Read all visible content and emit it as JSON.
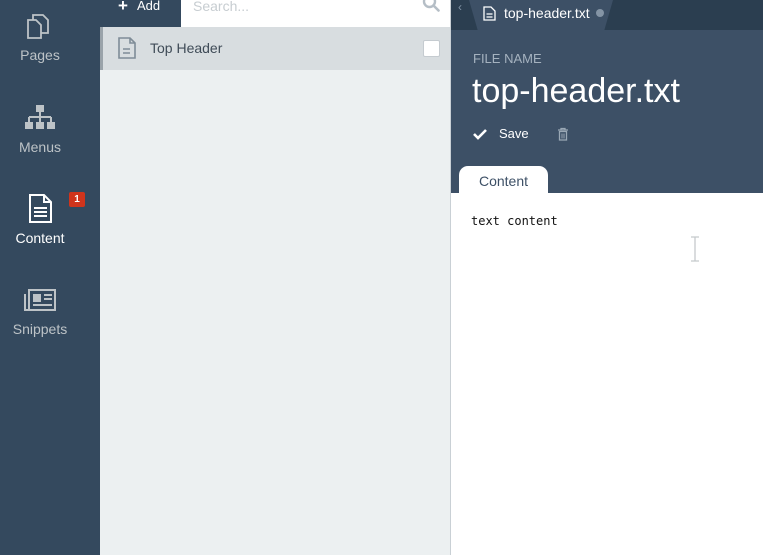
{
  "nav": {
    "items": [
      {
        "label": "Pages",
        "icon": "pages-icon"
      },
      {
        "label": "Menus",
        "icon": "menus-icon"
      },
      {
        "label": "Content",
        "icon": "content-icon",
        "active": true,
        "badge": "1"
      },
      {
        "label": "Snippets",
        "icon": "snippets-icon"
      }
    ]
  },
  "toolbar": {
    "add_label": "Add",
    "search_placeholder": "Search..."
  },
  "list": {
    "items": [
      {
        "name": "Top Header",
        "selected": true,
        "checked": false
      }
    ]
  },
  "editor": {
    "tab_title": "top-header.txt",
    "file_name_label": "FILE NAME",
    "file_name": "top-header.txt",
    "save_label": "Save",
    "content_tab": "Content",
    "content_text": "text content"
  },
  "colors": {
    "nav_bg": "#34495e",
    "header_bg": "#3d5066",
    "badge": "#d0341c",
    "list_bg": "#ecf0f1"
  }
}
